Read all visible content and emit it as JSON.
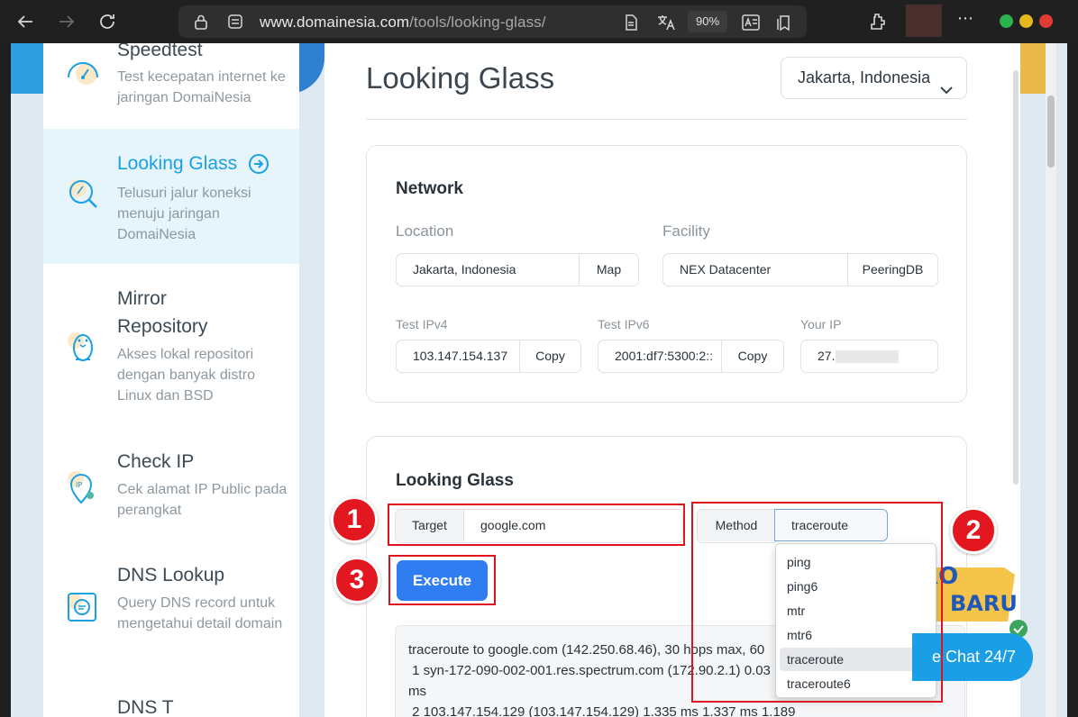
{
  "browser": {
    "url_domain": "www.domainesia.com",
    "url_path": "/tools/looking-glass/",
    "zoom": "90%",
    "icons": [
      "back-icon",
      "forward-icon",
      "reload-icon",
      "lock-icon",
      "site-settings-icon",
      "reader-mode-icon",
      "translate-icon",
      "immersive-reader-icon",
      "favorites-icon",
      "extensions-icon",
      "more-icon"
    ]
  },
  "sidebar": {
    "items": [
      {
        "title": "Speedtest",
        "desc": "Test kecepatan internet ke jaringan DomaiNesia",
        "icon": "speedometer-icon"
      },
      {
        "title": "Looking Glass",
        "desc": "Telusuri jalur koneksi menuju jaringan DomaiNesia",
        "icon": "magnifier-icon",
        "active": true
      },
      {
        "title": "Mirror Repository",
        "desc": "Akses lokal repositori dengan banyak distro Linux dan BSD",
        "icon": "penguin-icon"
      },
      {
        "title": "Check IP",
        "desc": "Cek alamat IP Public pada perangkat",
        "icon": "ip-pin-icon"
      },
      {
        "title": "DNS Lookup",
        "desc": "Query DNS record untuk mengetahui detail domain",
        "icon": "dns-search-icon"
      },
      {
        "title": "DNS T",
        "desc": "",
        "icon": "dns-icon"
      }
    ]
  },
  "main": {
    "title": "Looking Glass",
    "location_select": "Jakarta, Indonesia"
  },
  "network": {
    "heading": "Network",
    "location_label": "Location",
    "location_value": "Jakarta, Indonesia",
    "map_button": "Map",
    "facility_label": "Facility",
    "facility_value": "NEX Datacenter",
    "peeringdb_button": "PeeringDB",
    "ipv4_label": "Test IPv4",
    "ipv4_value": "103.147.154.137",
    "ipv6_label": "Test IPv6",
    "ipv6_value": "2001:df7:5300:2::",
    "copy_label": "Copy",
    "your_ip_label": "Your IP",
    "your_ip_value": "27.1"
  },
  "lg": {
    "heading": "Looking Glass",
    "target_label": "Target",
    "target_value": "google.com",
    "method_label": "Method",
    "method_value": "traceroute",
    "execute": "Execute",
    "options": [
      "ping",
      "ping6",
      "mtr",
      "mtr6",
      "traceroute",
      "traceroute6"
    ],
    "selected_option": "traceroute",
    "output_lines": [
      "traceroute to google.com (142.250.68.46), 30 hops max, 60",
      " 1 syn-172-090-002-001.res.spectrum.com (172.90.2.1) 0.03",
      "ms",
      " 2 103.147.154.129 (103.147.154.129) 1.335 ms 1.337 ms 1.189"
    ]
  },
  "annotations": {
    "badge1": "1",
    "badge2": "2",
    "badge3": "3"
  },
  "promo": {
    "line1": "PRO",
    "line2": "BARU"
  },
  "chat_label": "e Chat 24/7",
  "colors": {
    "accent": "#1aa0e3",
    "button": "#2f7df0",
    "annotation": "#e0141e"
  }
}
